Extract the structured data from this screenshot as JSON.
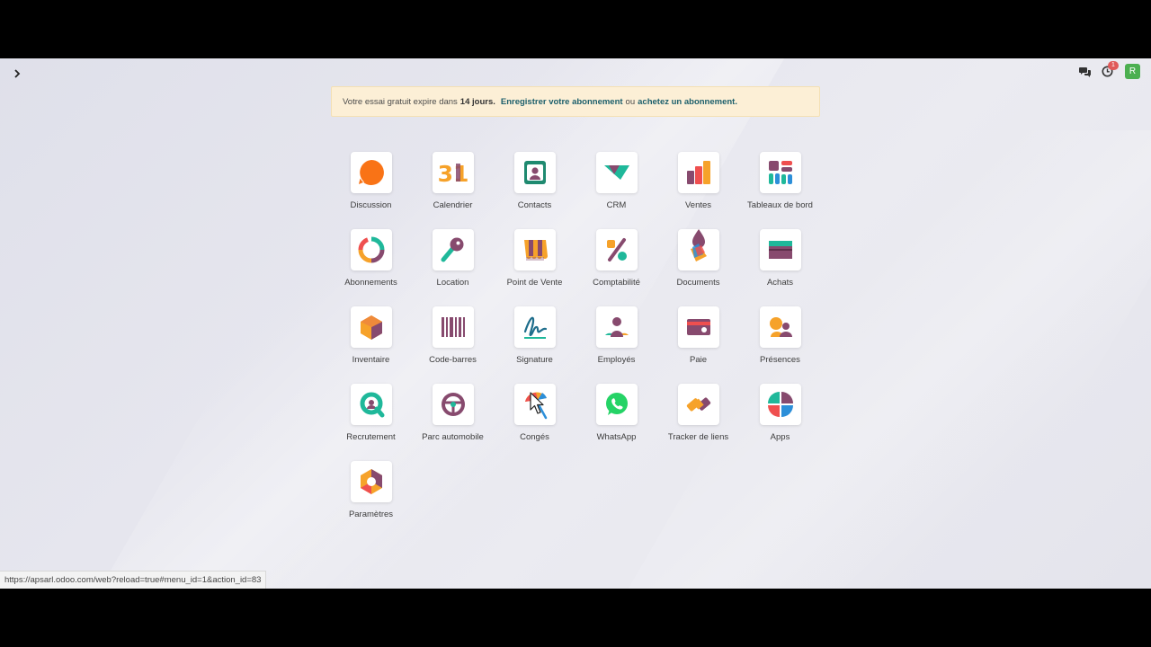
{
  "trial": {
    "text_before": "Votre essai gratuit expire dans",
    "days": "14 jours.",
    "register_link": "Enregistrer votre abonnement",
    "or": "ou",
    "buy_link": "achetez un abonnement."
  },
  "topbar": {
    "notification_count": "1",
    "avatar_letter": "R"
  },
  "apps": [
    {
      "label": "Discussion",
      "icon": "discussion-icon"
    },
    {
      "label": "Calendrier",
      "icon": "calendar-icon",
      "glyph": "31"
    },
    {
      "label": "Contacts",
      "icon": "contacts-icon"
    },
    {
      "label": "CRM",
      "icon": "crm-icon"
    },
    {
      "label": "Ventes",
      "icon": "sales-icon"
    },
    {
      "label": "Tableaux de bord",
      "icon": "dashboards-icon"
    },
    {
      "label": "Abonnements",
      "icon": "subscriptions-icon"
    },
    {
      "label": "Location",
      "icon": "rental-icon"
    },
    {
      "label": "Point de Vente",
      "icon": "point-of-sale-icon"
    },
    {
      "label": "Comptabilité",
      "icon": "accounting-icon"
    },
    {
      "label": "Documents",
      "icon": "documents-icon"
    },
    {
      "label": "Achats",
      "icon": "purchase-icon"
    },
    {
      "label": "Inventaire",
      "icon": "inventory-icon"
    },
    {
      "label": "Code-barres",
      "icon": "barcode-icon"
    },
    {
      "label": "Signature",
      "icon": "signature-icon"
    },
    {
      "label": "Employés",
      "icon": "employees-icon"
    },
    {
      "label": "Paie",
      "icon": "payroll-icon"
    },
    {
      "label": "Présences",
      "icon": "attendances-icon"
    },
    {
      "label": "Recrutement",
      "icon": "recruitment-icon"
    },
    {
      "label": "Parc automobile",
      "icon": "fleet-icon"
    },
    {
      "label": "Congés",
      "icon": "time-off-icon"
    },
    {
      "label": "WhatsApp",
      "icon": "whatsapp-icon"
    },
    {
      "label": "Tracker de liens",
      "icon": "link-tracker-icon"
    },
    {
      "label": "Apps",
      "icon": "apps-icon"
    },
    {
      "label": "Paramètres",
      "icon": "settings-icon"
    }
  ],
  "status_bar": {
    "url": "https://apsarl.odoo.com/web?reload=true#menu_id=1&action_id=83"
  }
}
